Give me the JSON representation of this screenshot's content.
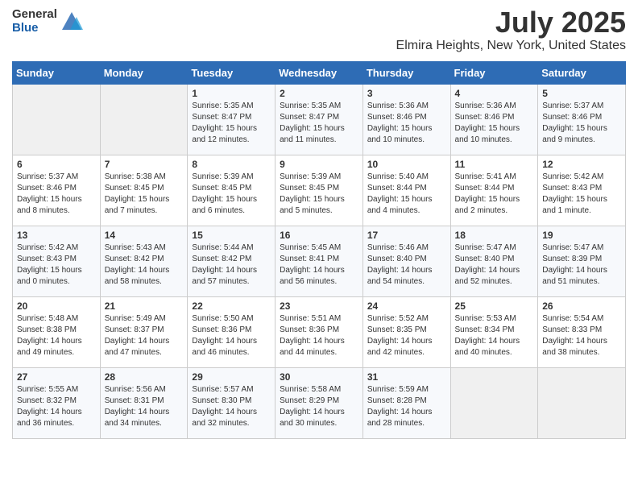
{
  "header": {
    "logo_general": "General",
    "logo_blue": "Blue",
    "month_year": "July 2025",
    "location": "Elmira Heights, New York, United States"
  },
  "days_of_week": [
    "Sunday",
    "Monday",
    "Tuesday",
    "Wednesday",
    "Thursday",
    "Friday",
    "Saturday"
  ],
  "weeks": [
    [
      {
        "day": "",
        "sunrise": "",
        "sunset": "",
        "daylight": ""
      },
      {
        "day": "",
        "sunrise": "",
        "sunset": "",
        "daylight": ""
      },
      {
        "day": "1",
        "sunrise": "Sunrise: 5:35 AM",
        "sunset": "Sunset: 8:47 PM",
        "daylight": "Daylight: 15 hours and 12 minutes."
      },
      {
        "day": "2",
        "sunrise": "Sunrise: 5:35 AM",
        "sunset": "Sunset: 8:47 PM",
        "daylight": "Daylight: 15 hours and 11 minutes."
      },
      {
        "day": "3",
        "sunrise": "Sunrise: 5:36 AM",
        "sunset": "Sunset: 8:46 PM",
        "daylight": "Daylight: 15 hours and 10 minutes."
      },
      {
        "day": "4",
        "sunrise": "Sunrise: 5:36 AM",
        "sunset": "Sunset: 8:46 PM",
        "daylight": "Daylight: 15 hours and 10 minutes."
      },
      {
        "day": "5",
        "sunrise": "Sunrise: 5:37 AM",
        "sunset": "Sunset: 8:46 PM",
        "daylight": "Daylight: 15 hours and 9 minutes."
      }
    ],
    [
      {
        "day": "6",
        "sunrise": "Sunrise: 5:37 AM",
        "sunset": "Sunset: 8:46 PM",
        "daylight": "Daylight: 15 hours and 8 minutes."
      },
      {
        "day": "7",
        "sunrise": "Sunrise: 5:38 AM",
        "sunset": "Sunset: 8:45 PM",
        "daylight": "Daylight: 15 hours and 7 minutes."
      },
      {
        "day": "8",
        "sunrise": "Sunrise: 5:39 AM",
        "sunset": "Sunset: 8:45 PM",
        "daylight": "Daylight: 15 hours and 6 minutes."
      },
      {
        "day": "9",
        "sunrise": "Sunrise: 5:39 AM",
        "sunset": "Sunset: 8:45 PM",
        "daylight": "Daylight: 15 hours and 5 minutes."
      },
      {
        "day": "10",
        "sunrise": "Sunrise: 5:40 AM",
        "sunset": "Sunset: 8:44 PM",
        "daylight": "Daylight: 15 hours and 4 minutes."
      },
      {
        "day": "11",
        "sunrise": "Sunrise: 5:41 AM",
        "sunset": "Sunset: 8:44 PM",
        "daylight": "Daylight: 15 hours and 2 minutes."
      },
      {
        "day": "12",
        "sunrise": "Sunrise: 5:42 AM",
        "sunset": "Sunset: 8:43 PM",
        "daylight": "Daylight: 15 hours and 1 minute."
      }
    ],
    [
      {
        "day": "13",
        "sunrise": "Sunrise: 5:42 AM",
        "sunset": "Sunset: 8:43 PM",
        "daylight": "Daylight: 15 hours and 0 minutes."
      },
      {
        "day": "14",
        "sunrise": "Sunrise: 5:43 AM",
        "sunset": "Sunset: 8:42 PM",
        "daylight": "Daylight: 14 hours and 58 minutes."
      },
      {
        "day": "15",
        "sunrise": "Sunrise: 5:44 AM",
        "sunset": "Sunset: 8:42 PM",
        "daylight": "Daylight: 14 hours and 57 minutes."
      },
      {
        "day": "16",
        "sunrise": "Sunrise: 5:45 AM",
        "sunset": "Sunset: 8:41 PM",
        "daylight": "Daylight: 14 hours and 56 minutes."
      },
      {
        "day": "17",
        "sunrise": "Sunrise: 5:46 AM",
        "sunset": "Sunset: 8:40 PM",
        "daylight": "Daylight: 14 hours and 54 minutes."
      },
      {
        "day": "18",
        "sunrise": "Sunrise: 5:47 AM",
        "sunset": "Sunset: 8:40 PM",
        "daylight": "Daylight: 14 hours and 52 minutes."
      },
      {
        "day": "19",
        "sunrise": "Sunrise: 5:47 AM",
        "sunset": "Sunset: 8:39 PM",
        "daylight": "Daylight: 14 hours and 51 minutes."
      }
    ],
    [
      {
        "day": "20",
        "sunrise": "Sunrise: 5:48 AM",
        "sunset": "Sunset: 8:38 PM",
        "daylight": "Daylight: 14 hours and 49 minutes."
      },
      {
        "day": "21",
        "sunrise": "Sunrise: 5:49 AM",
        "sunset": "Sunset: 8:37 PM",
        "daylight": "Daylight: 14 hours and 47 minutes."
      },
      {
        "day": "22",
        "sunrise": "Sunrise: 5:50 AM",
        "sunset": "Sunset: 8:36 PM",
        "daylight": "Daylight: 14 hours and 46 minutes."
      },
      {
        "day": "23",
        "sunrise": "Sunrise: 5:51 AM",
        "sunset": "Sunset: 8:36 PM",
        "daylight": "Daylight: 14 hours and 44 minutes."
      },
      {
        "day": "24",
        "sunrise": "Sunrise: 5:52 AM",
        "sunset": "Sunset: 8:35 PM",
        "daylight": "Daylight: 14 hours and 42 minutes."
      },
      {
        "day": "25",
        "sunrise": "Sunrise: 5:53 AM",
        "sunset": "Sunset: 8:34 PM",
        "daylight": "Daylight: 14 hours and 40 minutes."
      },
      {
        "day": "26",
        "sunrise": "Sunrise: 5:54 AM",
        "sunset": "Sunset: 8:33 PM",
        "daylight": "Daylight: 14 hours and 38 minutes."
      }
    ],
    [
      {
        "day": "27",
        "sunrise": "Sunrise: 5:55 AM",
        "sunset": "Sunset: 8:32 PM",
        "daylight": "Daylight: 14 hours and 36 minutes."
      },
      {
        "day": "28",
        "sunrise": "Sunrise: 5:56 AM",
        "sunset": "Sunset: 8:31 PM",
        "daylight": "Daylight: 14 hours and 34 minutes."
      },
      {
        "day": "29",
        "sunrise": "Sunrise: 5:57 AM",
        "sunset": "Sunset: 8:30 PM",
        "daylight": "Daylight: 14 hours and 32 minutes."
      },
      {
        "day": "30",
        "sunrise": "Sunrise: 5:58 AM",
        "sunset": "Sunset: 8:29 PM",
        "daylight": "Daylight: 14 hours and 30 minutes."
      },
      {
        "day": "31",
        "sunrise": "Sunrise: 5:59 AM",
        "sunset": "Sunset: 8:28 PM",
        "daylight": "Daylight: 14 hours and 28 minutes."
      },
      {
        "day": "",
        "sunrise": "",
        "sunset": "",
        "daylight": ""
      },
      {
        "day": "",
        "sunrise": "",
        "sunset": "",
        "daylight": ""
      }
    ]
  ]
}
